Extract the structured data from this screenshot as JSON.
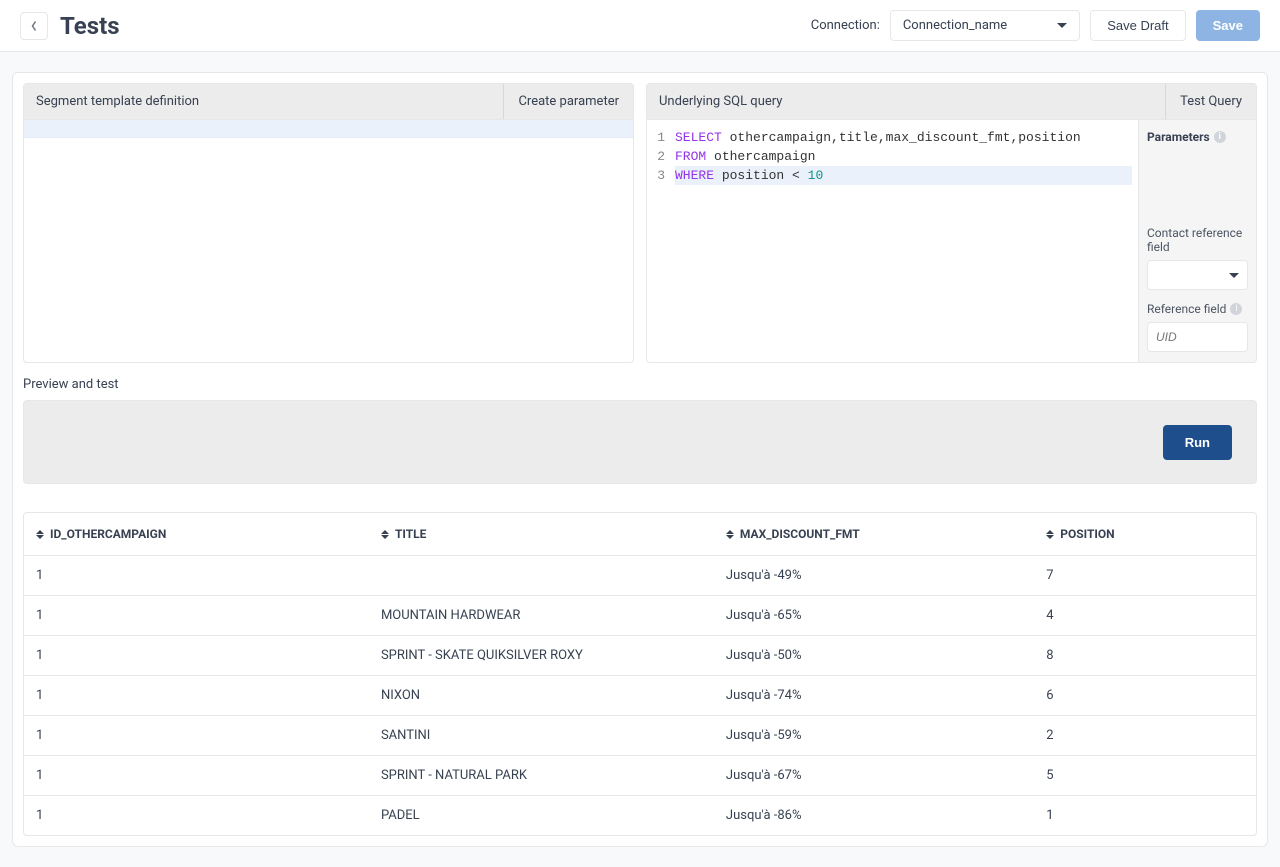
{
  "header": {
    "title": "Tests",
    "connection_label": "Connection:",
    "connection_value": "Connection_name",
    "save_draft_label": "Save Draft",
    "save_label": "Save"
  },
  "segment_panel": {
    "title": "Segment template definition",
    "action_label": "Create parameter"
  },
  "sql_panel": {
    "title": "Underlying SQL query",
    "action_label": "Test Query",
    "code": {
      "lines": [
        {
          "n": "1",
          "tokens": [
            [
              "kw",
              "SELECT"
            ],
            [
              "",
              " othercampaign,title,max_discount_fmt,position"
            ]
          ]
        },
        {
          "n": "2",
          "tokens": [
            [
              "kw",
              "FROM"
            ],
            [
              "",
              " othercampaign"
            ]
          ]
        },
        {
          "n": "3",
          "tokens": [
            [
              "kw",
              "WHERE"
            ],
            [
              "",
              " position < "
            ],
            [
              "num",
              "10"
            ]
          ],
          "hl": true
        }
      ]
    },
    "params": {
      "title": "Parameters",
      "contact_label": "Contact reference field",
      "ref_label": "Reference field",
      "ref_placeholder": "UID"
    }
  },
  "preview": {
    "label": "Preview and test",
    "run_label": "Run"
  },
  "table": {
    "columns": [
      "ID_OTHERCAMPAIGN",
      "TITLE",
      "MAX_DISCOUNT_FMT",
      "POSITION"
    ],
    "rows": [
      {
        "id": "1",
        "title": "",
        "disc": "Jusqu'à -49%",
        "pos": "7"
      },
      {
        "id": "1",
        "title": "MOUNTAIN HARDWEAR",
        "disc": "Jusqu'à -65%",
        "pos": "4"
      },
      {
        "id": "1",
        "title": "SPRINT - SKATE QUIKSILVER ROXY",
        "disc": "Jusqu'à -50%",
        "pos": "8"
      },
      {
        "id": "1",
        "title": "NIXON",
        "disc": "Jusqu'à -74%",
        "pos": "6"
      },
      {
        "id": "1",
        "title": "SANTINI",
        "disc": "Jusqu'à -59%",
        "pos": "2"
      },
      {
        "id": "1",
        "title": "SPRINT - NATURAL PARK",
        "disc": "Jusqu'à -67%",
        "pos": "5"
      },
      {
        "id": "1",
        "title": "PADEL",
        "disc": "Jusqu'à -86%",
        "pos": "1"
      }
    ]
  }
}
